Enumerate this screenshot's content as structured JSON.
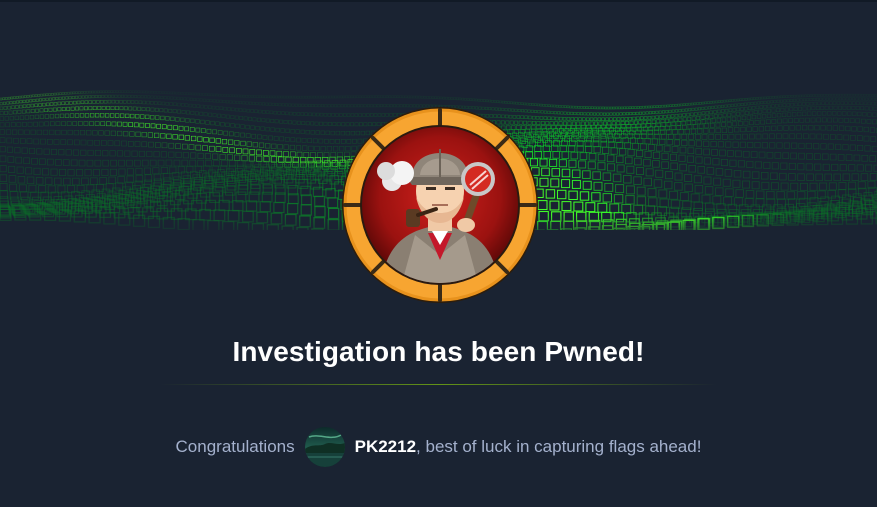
{
  "machine": {
    "title": "Investigation has been Pwned!",
    "badge_icon": "detective-badge-icon"
  },
  "message": {
    "prefix": "Congratulations",
    "username": "PK2212",
    "suffix": ", best of luck in capturing flags ahead!"
  },
  "colors": {
    "background": "#1a2332",
    "accent_green": "#9fef00",
    "badge_orange": "#f7a531",
    "text_muted": "#a4b1cd",
    "title": "#ffffff"
  }
}
